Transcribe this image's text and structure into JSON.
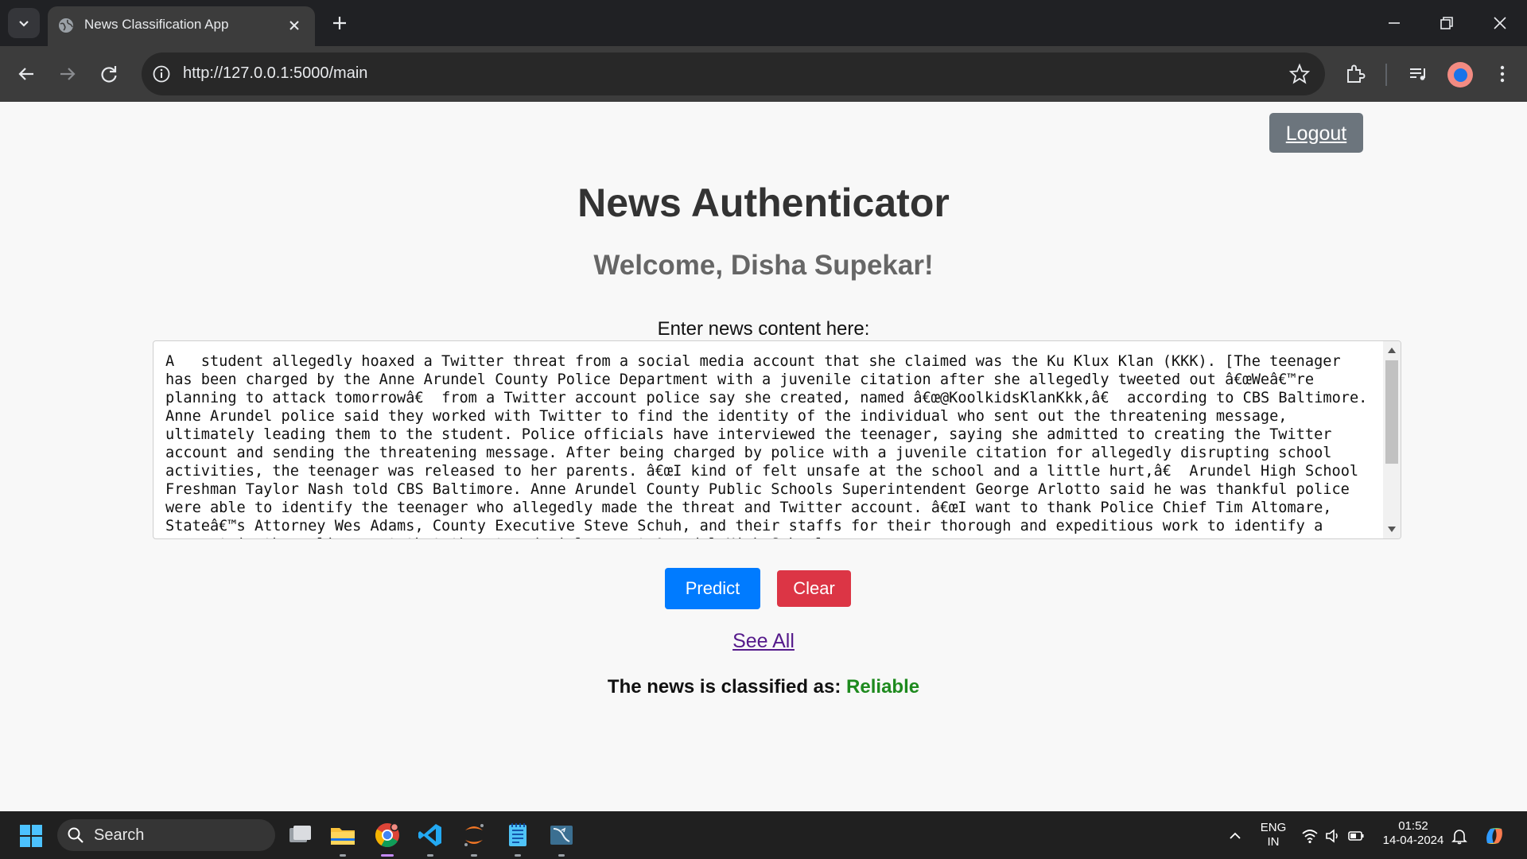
{
  "browser": {
    "tab_title": "News Classification App",
    "url": "http://127.0.0.1:5000/main"
  },
  "page": {
    "logout_label": "Logout",
    "heading": "News Authenticator",
    "welcome": "Welcome, Disha Supekar!",
    "input_label": "Enter news content here:",
    "news_text": "A   student allegedly hoaxed a Twitter threat from a social media account that she claimed was the Ku Klux Klan (KKK). [The teenager has been charged by the Anne Arundel County Police Department with a juvenile citation after she allegedly tweeted out â€œWeâ€™re planning to attack tomorrowâ€ from a Twitter account police say she created, named â€œ@KoolkidsKlanKkk,â€ according to CBS Baltimore.  Anne Arundel police said they worked with Twitter to find the identity of the individual who sent out the threatening message, ultimately leading them to the student. Police officials have interviewed the teenager, saying she admitted to creating the Twitter account and sending the threatening message. After being charged by police with a juvenile citation for allegedly disrupting school activities, the teenager was released to her parents. â€œI kind of felt unsafe at the school and a little hurt,â€ Arundel High School Freshman Taylor Nash told CBS Baltimore. Anne Arundel County Public Schools Superintendent George Arlotto said he was thankful police were able to identify the teenager who allegedly made the threat and Twitter account. â€œI want to thank Police Chief Tim Altomare, Stateâ€™s Attorney Wes Adams, County Executive Steve Schuh, and their staffs for their thorough and expeditious work to identify a suspect in the online post that threatened violence at Arundel High School",
    "predict_label": "Predict",
    "clear_label": "Clear",
    "see_all_label": "See All",
    "result_prefix": "The news is classified as:",
    "result_value": "Reliable"
  },
  "taskbar": {
    "search_label": "Search",
    "lang_line1": "ENG",
    "lang_line2": "IN",
    "time": "01:52",
    "date": "14-04-2024"
  },
  "colors": {
    "predict": "#007bff",
    "clear": "#dc3545",
    "logout": "#6c757d",
    "result_status": "#1e8a1e"
  }
}
